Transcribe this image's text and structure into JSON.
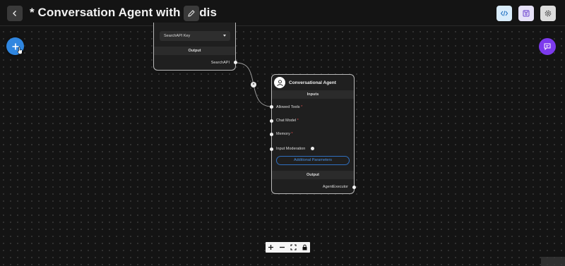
{
  "header": {
    "title": "* Conversation Agent with Redis"
  },
  "nodes": {
    "searchapi": {
      "select_value": "SearchAPI Key",
      "output_label": "Output",
      "output_port": "SearchAPI"
    },
    "agent": {
      "title": "Conversational Agent",
      "inputs_label": "Inputs",
      "inputs": [
        {
          "label": "Allowed Tools",
          "required": "*"
        },
        {
          "label": "Chat Model",
          "required": "*"
        },
        {
          "label": "Memory",
          "required": "*"
        },
        {
          "label": "Input Moderation",
          "required": ""
        }
      ],
      "additional_params_label": "Additional Parameters",
      "output_label": "Output",
      "output_port": "AgentExecutor"
    }
  },
  "colors": {
    "canvas": "#141414",
    "accent_blue": "#2f86e0",
    "chat_purple": "#7c3aed",
    "required_red": "#e04a4a"
  },
  "icons": [
    "back-icon",
    "pencil-icon",
    "code-icon",
    "save-icon",
    "gear-icon",
    "plus-icon",
    "chat-icon",
    "agent-icon",
    "zoom-in-icon",
    "zoom-out-icon",
    "fit-view-icon",
    "lock-icon",
    "close-icon"
  ]
}
